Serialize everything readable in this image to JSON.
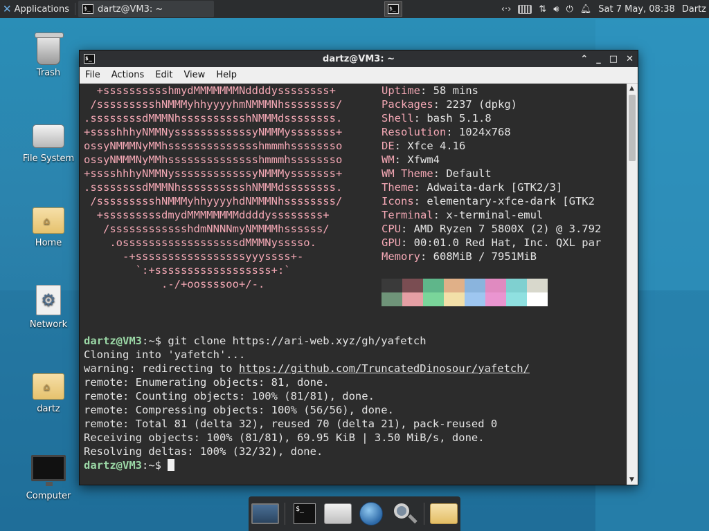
{
  "top_panel": {
    "applications_label": "Applications",
    "task_title": "dartz@VM3: ~",
    "clock": "Sat  7 May, 08:38",
    "user": "Dartz"
  },
  "desktop_icons": [
    {
      "label": "Trash",
      "icon": "trash-icon"
    },
    {
      "label": "File System",
      "icon": "drive-icon"
    },
    {
      "label": "Home",
      "icon": "home-folder-icon"
    },
    {
      "label": "Network",
      "icon": "network-icon"
    },
    {
      "label": "dartz",
      "icon": "folder-icon"
    },
    {
      "label": "Computer",
      "icon": "monitor-icon"
    }
  ],
  "window": {
    "title": "dartz@VM3: ~",
    "menu": [
      "File",
      "Actions",
      "Edit",
      "View",
      "Help"
    ]
  },
  "neofetch": {
    "logo": [
      "  +sssssssssshmydMMMMMMMNddddyssssssss+",
      " /ssssssssshNMMMyhhyyyyhmNMMMNhssssssss/",
      ".ssssssssdMMMNhsssssssssshNMMMdssssssss.",
      "+sssshhhyNMMNyssssssssssssyNMMMysssssss+",
      "ossyNMMMNyMMhsssssssssssssshmmmhssssssso",
      "ossyNMMMNyMMhsssssssssssssshmmmhssssssso",
      "+sssshhhyNMMNyssssssssssssyNMMMysssssss+",
      ".ssssssssdMMMNhsssssssssshNMMMdssssssss.",
      " /ssssssssshNMMMyhhyyyyhdNMMMNhssssssss/",
      "  +sssssssssdmydMMMMMMMMddddyssssssss+",
      "   /sssssssssssshdmNNNNmyNMMMMhssssss/",
      "    .ossssssssssssssssssdMMMNysssso.",
      "      -+sssssssssssssssssyyyssss+-",
      "        `:+ssssssssssssssssss+:`",
      "            .-/+oossssoo+/-."
    ],
    "info": [
      {
        "key": "Uptime",
        "value": "58 mins"
      },
      {
        "key": "Packages",
        "value": "2237 (dpkg)"
      },
      {
        "key": "Shell",
        "value": "bash 5.1.8"
      },
      {
        "key": "Resolution",
        "value": "1024x768"
      },
      {
        "key": "DE",
        "value": "Xfce 4.16"
      },
      {
        "key": "WM",
        "value": "Xfwm4"
      },
      {
        "key": "WM Theme",
        "value": "Default"
      },
      {
        "key": "Theme",
        "value": "Adwaita-dark [GTK2/3]"
      },
      {
        "key": "Icons",
        "value": "elementary-xfce-dark [GTK2"
      },
      {
        "key": "Terminal",
        "value": "x-terminal-emul"
      },
      {
        "key": "CPU",
        "value": "AMD Ryzen 7 5800X (2) @ 3.792"
      },
      {
        "key": "GPU",
        "value": "00:01.0 Red Hat, Inc. QXL par"
      },
      {
        "key": "Memory",
        "value": "608MiB / 7951MiB"
      }
    ],
    "palette_dark": [
      "#3a3a3a",
      "#7a4d52",
      "#5fb68a",
      "#e0b088",
      "#8ab4dd",
      "#e08ac0",
      "#7fd0d0",
      "#d8d8cc"
    ],
    "palette_light": [
      "#6f9479",
      "#e59fa4",
      "#7ad59a",
      "#f2dfa8",
      "#9ec6f0",
      "#ea95d0",
      "#8fe0e0",
      "#ffffff"
    ]
  },
  "terminal": {
    "prompt_user": "dartz@VM3",
    "prompt_path": ":~$ ",
    "command": "git clone https://ari-web.xyz/gh/yafetch",
    "output": [
      {
        "text": "Cloning into 'yafetch'..."
      },
      {
        "prefix": "warning: redirecting to ",
        "url": "https://github.com/TruncatedDinosour/yafetch/"
      },
      {
        "text": "remote: Enumerating objects: 81, done."
      },
      {
        "text": "remote: Counting objects: 100% (81/81), done."
      },
      {
        "text": "remote: Compressing objects: 100% (56/56), done."
      },
      {
        "text": "remote: Total 81 (delta 32), reused 70 (delta 21), pack-reused 0"
      },
      {
        "text": "Receiving objects: 100% (81/81), 69.95 KiB | 3.50 MiB/s, done."
      },
      {
        "text": "Resolving deltas: 100% (32/32), done."
      }
    ]
  },
  "dock": [
    "workspace-icon",
    "terminal-icon",
    "file-manager-icon",
    "web-browser-icon",
    "search-icon",
    "folder-icon"
  ]
}
